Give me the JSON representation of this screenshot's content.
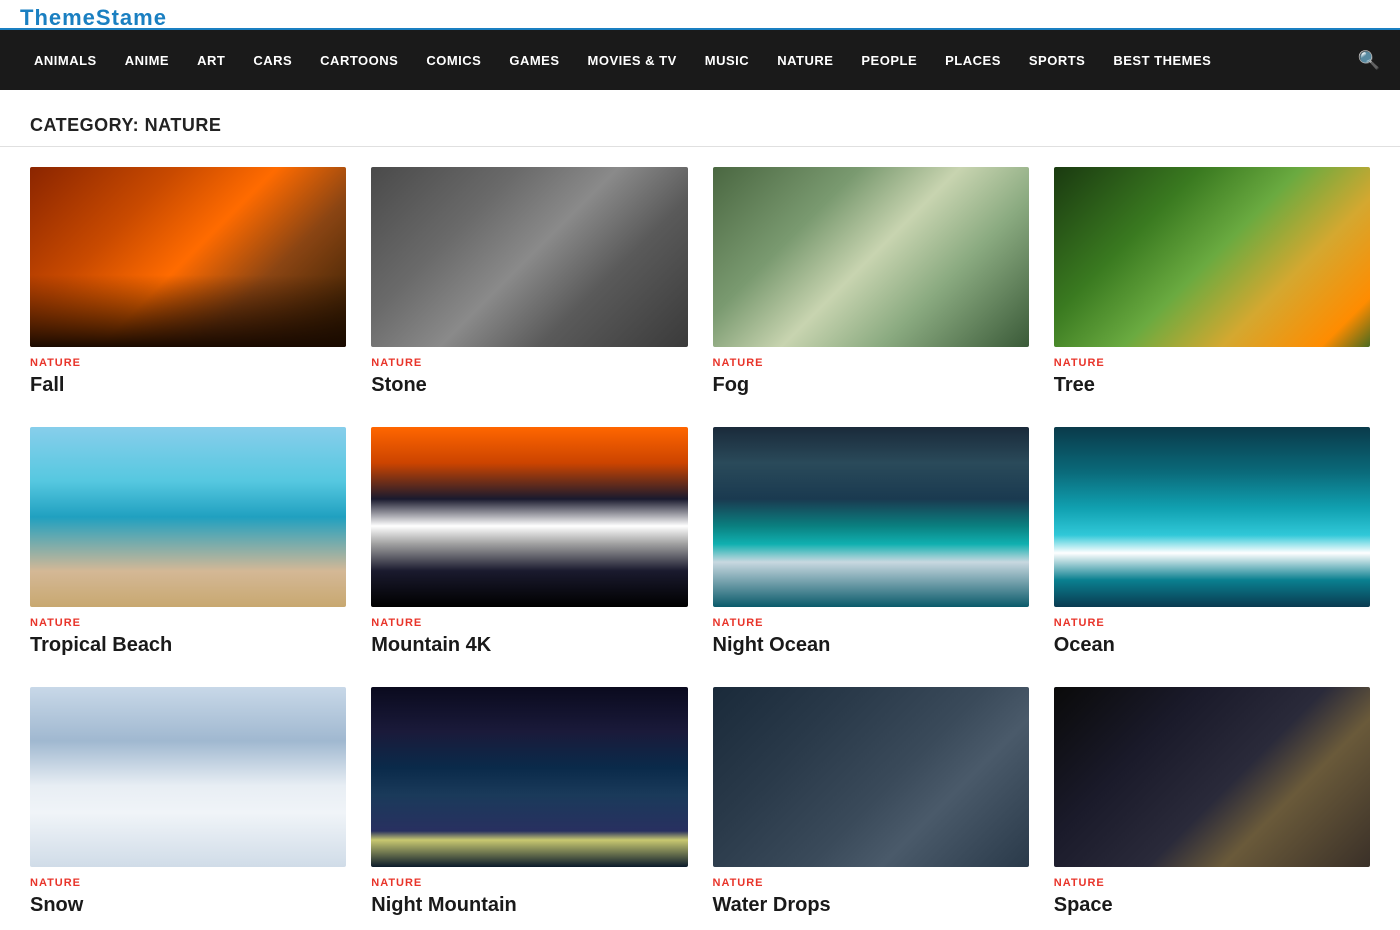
{
  "logo": {
    "text": "ThemeStame"
  },
  "nav": {
    "items": [
      {
        "label": "ANIMALS",
        "href": "#"
      },
      {
        "label": "ANIME",
        "href": "#"
      },
      {
        "label": "ART",
        "href": "#"
      },
      {
        "label": "CARS",
        "href": "#"
      },
      {
        "label": "CARTOONS",
        "href": "#"
      },
      {
        "label": "COMICS",
        "href": "#"
      },
      {
        "label": "GAMES",
        "href": "#"
      },
      {
        "label": "MOVIES & TV",
        "href": "#"
      },
      {
        "label": "MUSIC",
        "href": "#"
      },
      {
        "label": "NATURE",
        "href": "#"
      },
      {
        "label": "PEOPLE",
        "href": "#"
      },
      {
        "label": "PLACES",
        "href": "#"
      },
      {
        "label": "SPORTS",
        "href": "#"
      },
      {
        "label": "BEST THEMES",
        "href": "#"
      }
    ]
  },
  "category": {
    "heading": "CATEGORY: NATURE"
  },
  "cards": [
    {
      "category": "NATURE",
      "title": "Fall",
      "imgClass": "img-fall"
    },
    {
      "category": "NATURE",
      "title": "Stone",
      "imgClass": "img-stone"
    },
    {
      "category": "NATURE",
      "title": "Fog",
      "imgClass": "img-fog"
    },
    {
      "category": "NATURE",
      "title": "Tree",
      "imgClass": "img-tree"
    },
    {
      "category": "NATURE",
      "title": "Tropical Beach",
      "imgClass": "img-tropical"
    },
    {
      "category": "NATURE",
      "title": "Mountain 4K",
      "imgClass": "img-mountain"
    },
    {
      "category": "NATURE",
      "title": "Night Ocean",
      "imgClass": "img-night-ocean"
    },
    {
      "category": "NATURE",
      "title": "Ocean",
      "imgClass": "img-ocean"
    },
    {
      "category": "NATURE",
      "title": "Snow",
      "imgClass": "img-snow"
    },
    {
      "category": "NATURE",
      "title": "Night Mountain",
      "imgClass": "img-night-mountain"
    },
    {
      "category": "NATURE",
      "title": "Water Drops",
      "imgClass": "img-drops"
    },
    {
      "category": "NATURE",
      "title": "Space",
      "imgClass": "img-space"
    }
  ]
}
